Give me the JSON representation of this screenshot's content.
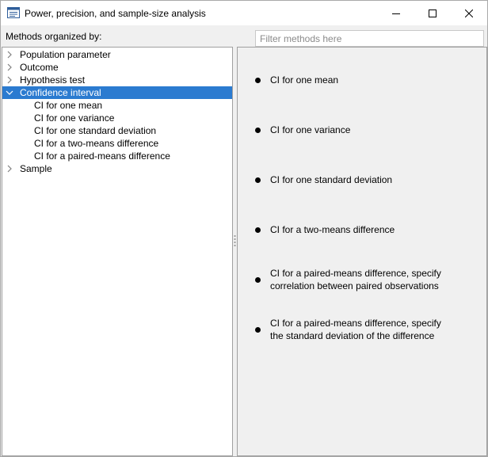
{
  "window": {
    "title": "Power, precision, and sample-size analysis"
  },
  "controls": {
    "methods_label": "Methods organized by:",
    "filter_placeholder": "Filter methods here",
    "filter_value": ""
  },
  "tree": {
    "items": [
      {
        "label": "Population parameter",
        "expanded": false,
        "selected": false
      },
      {
        "label": "Outcome",
        "expanded": false,
        "selected": false
      },
      {
        "label": "Hypothesis test",
        "expanded": false,
        "selected": false
      },
      {
        "label": "Confidence interval",
        "expanded": true,
        "selected": true,
        "children": [
          "CI for one mean",
          "CI for one variance",
          "CI for one standard deviation",
          "CI for a two-means difference",
          "CI for a paired-means difference"
        ]
      },
      {
        "label": "Sample",
        "expanded": false,
        "selected": false
      }
    ]
  },
  "methods": [
    {
      "line1": "CI for one mean",
      "line2": ""
    },
    {
      "line1": "CI for one variance",
      "line2": ""
    },
    {
      "line1": "CI for one standard deviation",
      "line2": ""
    },
    {
      "line1": "CI for a two-means difference",
      "line2": ""
    },
    {
      "line1": "CI for a paired-means difference, specify",
      "line2": "correlation between paired observations"
    },
    {
      "line1": "CI for a paired-means difference, specify",
      "line2": "the standard deviation of the difference"
    }
  ],
  "colors": {
    "selection": "#2b7bd0",
    "window_bg": "#f0f0f0",
    "pane_bg": "#ffffff"
  }
}
